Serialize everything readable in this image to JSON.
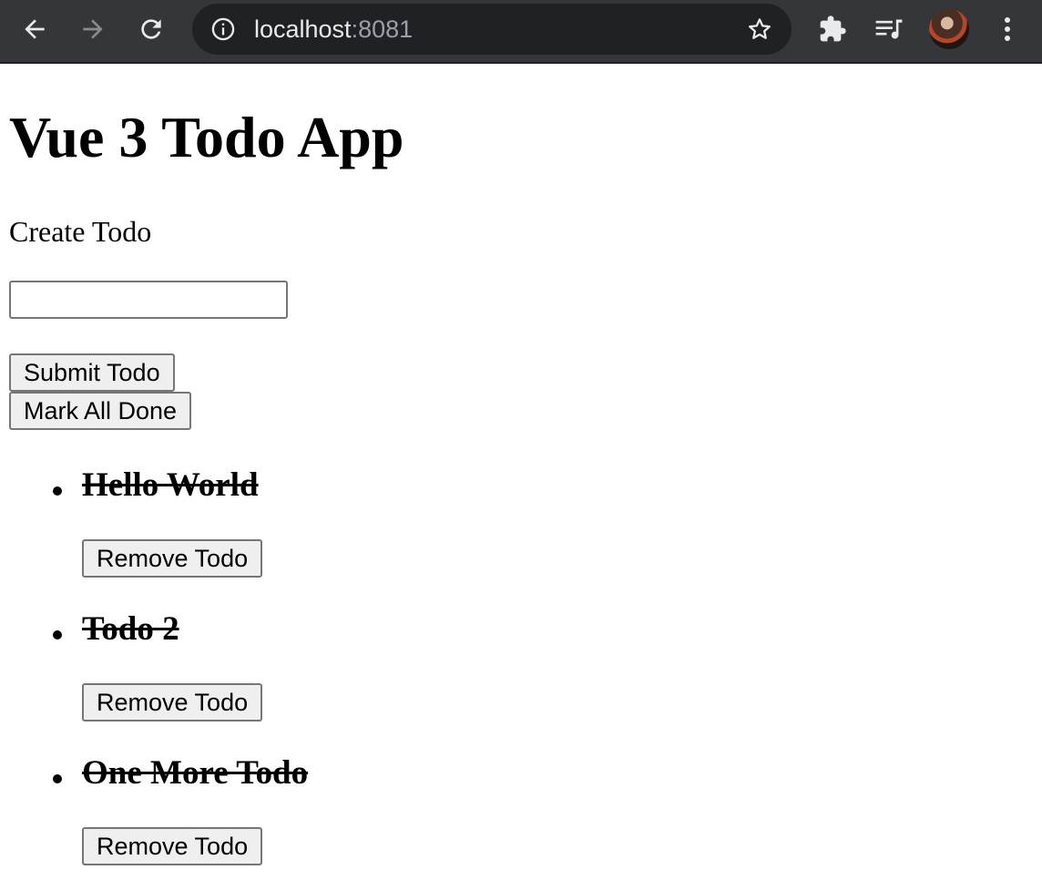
{
  "browser": {
    "url_host": "localhost",
    "url_port": ":8081",
    "icons": [
      "back-arrow-icon",
      "forward-arrow-icon",
      "reload-icon",
      "info-icon",
      "star-icon",
      "extensions-icon",
      "media-queue-icon",
      "profile-avatar",
      "menu-dots-icon"
    ]
  },
  "app": {
    "title": "Vue 3 Todo App",
    "create_label": "Create Todo",
    "input_value": "",
    "submit_label": "Submit Todo",
    "mark_all_label": "Mark All Done",
    "todos": [
      {
        "text": "Hello World",
        "done": true,
        "remove_label": "Remove Todo"
      },
      {
        "text": "Todo 2",
        "done": true,
        "remove_label": "Remove Todo"
      },
      {
        "text": "One More Todo",
        "done": true,
        "remove_label": "Remove Todo"
      }
    ]
  }
}
